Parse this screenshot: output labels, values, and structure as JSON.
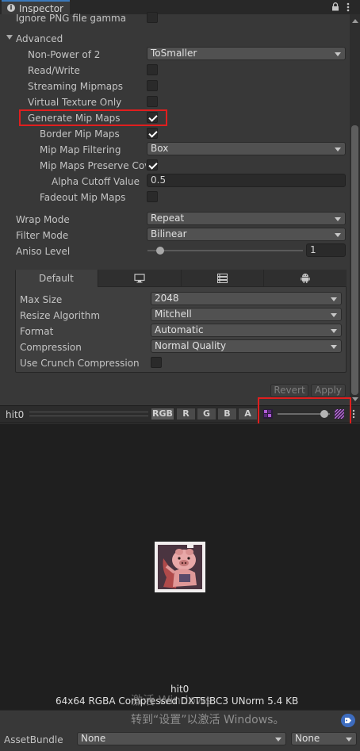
{
  "header": {
    "title": "Inspector",
    "lock_icon": "lock-icon",
    "menu_icon": "kebab-menu-icon"
  },
  "top_partial": {
    "label": "Ignore PNG file gamma"
  },
  "advanced": {
    "label": "Advanced",
    "non_power_of_2": {
      "label": "Non-Power of 2",
      "value": "ToSmaller"
    },
    "read_write": {
      "label": "Read/Write",
      "checked": false
    },
    "streaming_mipmaps": {
      "label": "Streaming Mipmaps",
      "checked": false
    },
    "virtual_texture_only": {
      "label": "Virtual Texture Only",
      "checked": false
    },
    "generate_mip_maps": {
      "label": "Generate Mip Maps",
      "checked": true
    },
    "border_mip_maps": {
      "label": "Border Mip Maps",
      "checked": true
    },
    "mip_map_filtering": {
      "label": "Mip Map Filtering",
      "value": "Box"
    },
    "mip_maps_preserve_coverage": {
      "label": "Mip Maps Preserve Cov",
      "checked": true
    },
    "alpha_cutoff_value": {
      "label": "Alpha Cutoff Value",
      "value": "0.5"
    },
    "fadeout_mip_maps": {
      "label": "Fadeout Mip Maps",
      "checked": false
    }
  },
  "wrap_mode": {
    "label": "Wrap Mode",
    "value": "Repeat"
  },
  "filter_mode": {
    "label": "Filter Mode",
    "value": "Bilinear"
  },
  "aniso_level": {
    "label": "Aniso Level",
    "value": "1",
    "slider_fraction": 0.0
  },
  "platform_tabs": [
    {
      "label": "Default",
      "icon": ""
    },
    {
      "label": "",
      "icon": "monitor-icon"
    },
    {
      "label": "",
      "icon": "server-icon"
    },
    {
      "label": "",
      "icon": "android-icon"
    }
  ],
  "platform_settings": {
    "max_size": {
      "label": "Max Size",
      "value": "2048"
    },
    "resize_algorithm": {
      "label": "Resize Algorithm",
      "value": "Mitchell"
    },
    "format": {
      "label": "Format",
      "value": "Automatic"
    },
    "compression": {
      "label": "Compression",
      "value": "Normal Quality"
    },
    "use_crunch_compression": {
      "label": "Use Crunch Compression",
      "checked": false
    }
  },
  "actions": {
    "revert": "Revert",
    "apply": "Apply"
  },
  "preview": {
    "name": "hit0",
    "channels": [
      "RGB",
      "R",
      "G",
      "B",
      "A"
    ],
    "mip_slider_fraction": 0.95,
    "caption_name": "hit0",
    "caption_info": "64x64  RGBA Compressed DXT5|BC3 UNorm   5.4 KB"
  },
  "watermark": {
    "line1": "激活 Windows",
    "line2": "转到“设置”以激活 Windows。"
  },
  "asset_bundle": {
    "label": "AssetBundle",
    "name_value": "None",
    "variant_value": "None"
  },
  "colors": {
    "highlight_red": "#e01e1e",
    "tab_accent": "#3a79bb"
  }
}
